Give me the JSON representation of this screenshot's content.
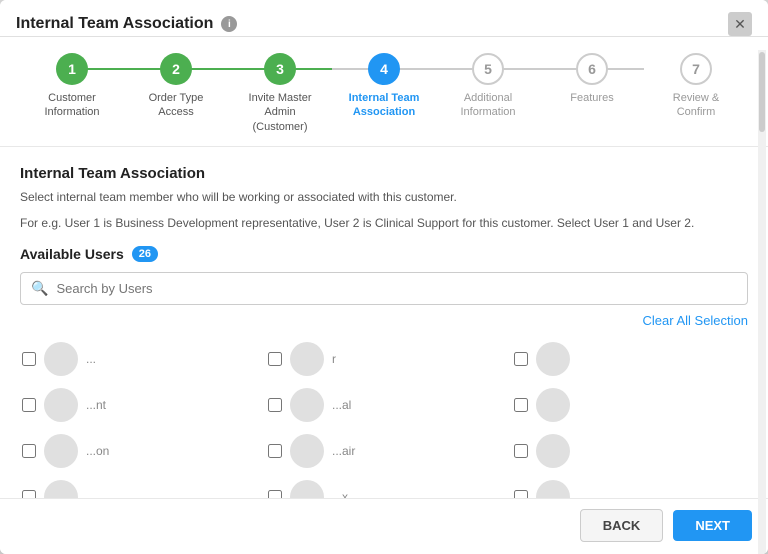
{
  "modal": {
    "title": "Internal Team Association",
    "close_label": "✕"
  },
  "stepper": {
    "steps": [
      {
        "number": "1",
        "label": "Customer Information",
        "state": "completed"
      },
      {
        "number": "2",
        "label": "Order Type Access",
        "state": "completed"
      },
      {
        "number": "3",
        "label": "Invite Master Admin (Customer)",
        "state": "completed"
      },
      {
        "number": "4",
        "label": "Internal Team Association",
        "state": "active"
      },
      {
        "number": "5",
        "label": "Additional Information",
        "state": "inactive"
      },
      {
        "number": "6",
        "label": "Features",
        "state": "inactive"
      },
      {
        "number": "7",
        "label": "Review & Confirm",
        "state": "inactive"
      }
    ]
  },
  "body": {
    "section_title": "Internal Team Association",
    "section_desc": "Select internal team member who will be working or associated with this customer.",
    "example_text": "For e.g. User 1 is Business Development representative, User 2 is Clinical Support for this customer. Select User 1 and User 2.",
    "available_users_label": "Available Users",
    "badge_count": "26",
    "search_placeholder": "Search by Users",
    "clear_label": "Clear All Selection",
    "users": [
      {
        "name": "...nt",
        "col": 0
      },
      {
        "name": "...on",
        "col": 0
      },
      {
        "name": "r",
        "col": 1
      },
      {
        "name": "...al",
        "col": 1
      },
      {
        "name": "...air",
        "col": 1
      },
      {
        "name": "...x",
        "col": 1
      }
    ]
  },
  "footer": {
    "back_label": "BACK",
    "next_label": "NEXT"
  }
}
